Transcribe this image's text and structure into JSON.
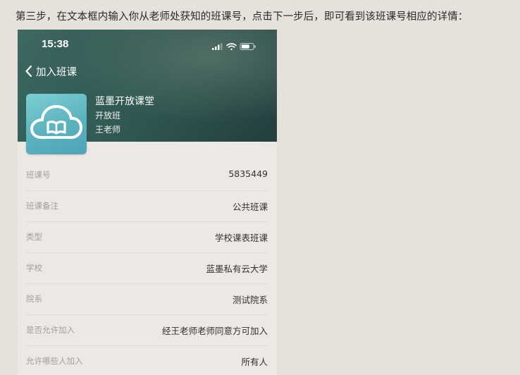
{
  "instruction": "第三步，在文本框内输入你从老师处获知的班课号，点击下一步后，即可看到该班课号相应的详情：",
  "status_bar": {
    "time": "15:38",
    "icons": [
      "signal-icon",
      "wifi-icon",
      "battery-icon"
    ]
  },
  "nav": {
    "back_label": "加入班课"
  },
  "class_info": {
    "name": "蓝墨开放课堂",
    "type": "开放班",
    "teacher": "王老师",
    "logo_icon": "cloud-book-icon",
    "logo_colors": [
      "#7ccfd2",
      "#4ea4b6"
    ]
  },
  "details": [
    {
      "label": "班课号",
      "value": "5835449"
    },
    {
      "label": "班课备注",
      "value": "公共班课"
    },
    {
      "label": "类型",
      "value": "学校课表班课"
    },
    {
      "label": "学校",
      "value": "蓝墨私有云大学"
    },
    {
      "label": "院系",
      "value": "测试院系"
    },
    {
      "label": "是否允许加入",
      "value": "经王老师老师同意方可加入"
    },
    {
      "label": "允许哪些人加入",
      "value": "所有人"
    }
  ],
  "colors": {
    "page_bg": "#e6e1db",
    "header_bg": "#2e5450",
    "label_text": "#a3a09c",
    "value_text": "#333333"
  }
}
